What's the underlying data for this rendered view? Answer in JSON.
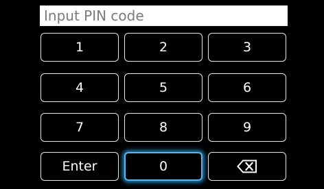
{
  "pin_field": {
    "value": "",
    "placeholder": "Input PIN code"
  },
  "keypad": {
    "keys": [
      {
        "label": "1"
      },
      {
        "label": "2"
      },
      {
        "label": "3"
      },
      {
        "label": "4"
      },
      {
        "label": "5"
      },
      {
        "label": "6"
      },
      {
        "label": "7"
      },
      {
        "label": "8"
      },
      {
        "label": "9"
      },
      {
        "label": "Enter"
      },
      {
        "label": "0"
      },
      {
        "label": "",
        "icon": "backspace-icon"
      }
    ],
    "focused_key": "0"
  },
  "colors": {
    "background": "#000000",
    "key_border": "#e9e9e9",
    "key_text": "#ffffff",
    "focus_glow": "#5fb4e8",
    "field_background": "#ffffff",
    "placeholder": "#7a7a7a"
  }
}
